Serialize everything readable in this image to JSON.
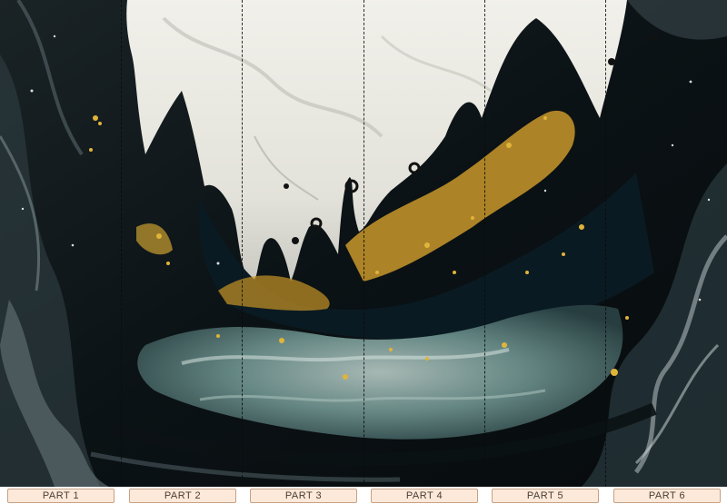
{
  "panels": [
    {
      "label": "PART 1"
    },
    {
      "label": "PART 2"
    },
    {
      "label": "PART 3"
    },
    {
      "label": "PART 4"
    },
    {
      "label": "PART 5"
    },
    {
      "label": "PART 6"
    }
  ],
  "colors": {
    "background_dark": "#0c1417",
    "cream": "#ecebe4",
    "gold": "#d4a42a",
    "teal": "#5e8a88",
    "label_fill": "#fde9d9",
    "label_border": "#c8a083"
  }
}
